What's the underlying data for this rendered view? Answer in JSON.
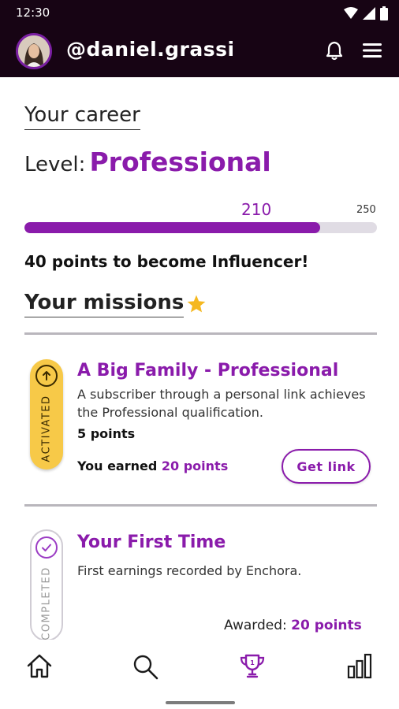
{
  "status_bar": {
    "time": "12:30"
  },
  "header": {
    "username": "@daniel.grassi"
  },
  "career": {
    "title": "Your career",
    "level_label": "Level:",
    "level_value": "Professional",
    "progress_current": "210",
    "progress_max": "250",
    "progress_fraction": 0.84,
    "points_message": "40 points to become Influencer!"
  },
  "missions": {
    "title": "Your missions",
    "items": [
      {
        "status": "ACTIVATED",
        "title": "A Big Family - Professional",
        "description": "A subscriber through a personal link achieves the Professional qualification.",
        "points": "5 points",
        "earned_prefix": "You earned",
        "earned_value": "20 points",
        "action_label": "Get link"
      },
      {
        "status": "COMPLETED",
        "title": "Your First Time",
        "description": "First earnings recorded by Enchora.",
        "awarded_prefix": "Awarded:",
        "awarded_value": "20 points"
      }
    ]
  },
  "colors": {
    "brand": "#8a1bab",
    "header_bg": "#170414",
    "active_badge": "#f7c948"
  },
  "bottom_nav": {
    "items": [
      "home-icon",
      "search-icon",
      "trophy-icon",
      "bar-chart-icon"
    ],
    "selected": "trophy-icon"
  }
}
